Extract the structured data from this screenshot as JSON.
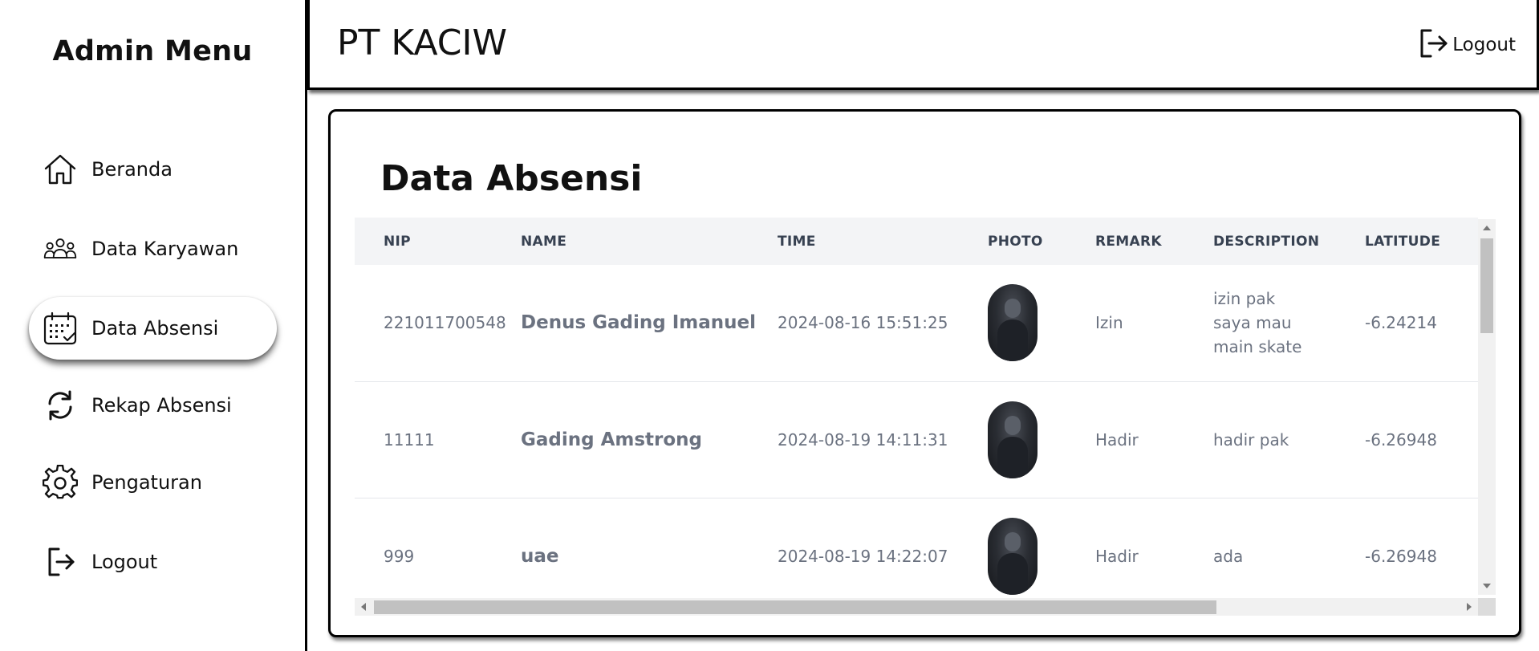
{
  "sidebar": {
    "title": "Admin Menu",
    "items": [
      {
        "label": "Beranda",
        "icon": "home-icon"
      },
      {
        "label": "Data Karyawan",
        "icon": "users-icon"
      },
      {
        "label": "Data Absensi",
        "icon": "calendar-icon",
        "active": true
      },
      {
        "label": "Rekap Absensi",
        "icon": "refresh-icon"
      },
      {
        "label": "Pengaturan",
        "icon": "gear-icon"
      },
      {
        "label": "Logout",
        "icon": "logout-icon"
      }
    ]
  },
  "header": {
    "company": "PT KACIW",
    "logout_label": "Logout"
  },
  "main": {
    "title": "Data Absensi",
    "table": {
      "columns": [
        "NIP",
        "NAME",
        "TIME",
        "PHOTO",
        "REMARK",
        "DESCRIPTION",
        "LATITUDE"
      ],
      "rows": [
        {
          "nip": "221011700548",
          "name": "Denus Gading Imanuel",
          "time": "2024-08-16 15:51:25",
          "remark": "Izin",
          "description": [
            "izin pak",
            "saya mau",
            "main skate"
          ],
          "latitude": "-6.24214"
        },
        {
          "nip": "11111",
          "name": "Gading Amstrong",
          "time": "2024-08-19 14:11:31",
          "remark": "Hadir",
          "description": [
            "hadir pak"
          ],
          "latitude": "-6.26948"
        },
        {
          "nip": "999",
          "name": "uae",
          "time": "2024-08-19 14:22:07",
          "remark": "Hadir",
          "description": [
            "ada"
          ],
          "latitude": "-6.26948"
        }
      ]
    }
  },
  "colors": {
    "border": "#000000",
    "table_header_bg": "#f3f4f6",
    "muted_text": "#6b7280"
  }
}
